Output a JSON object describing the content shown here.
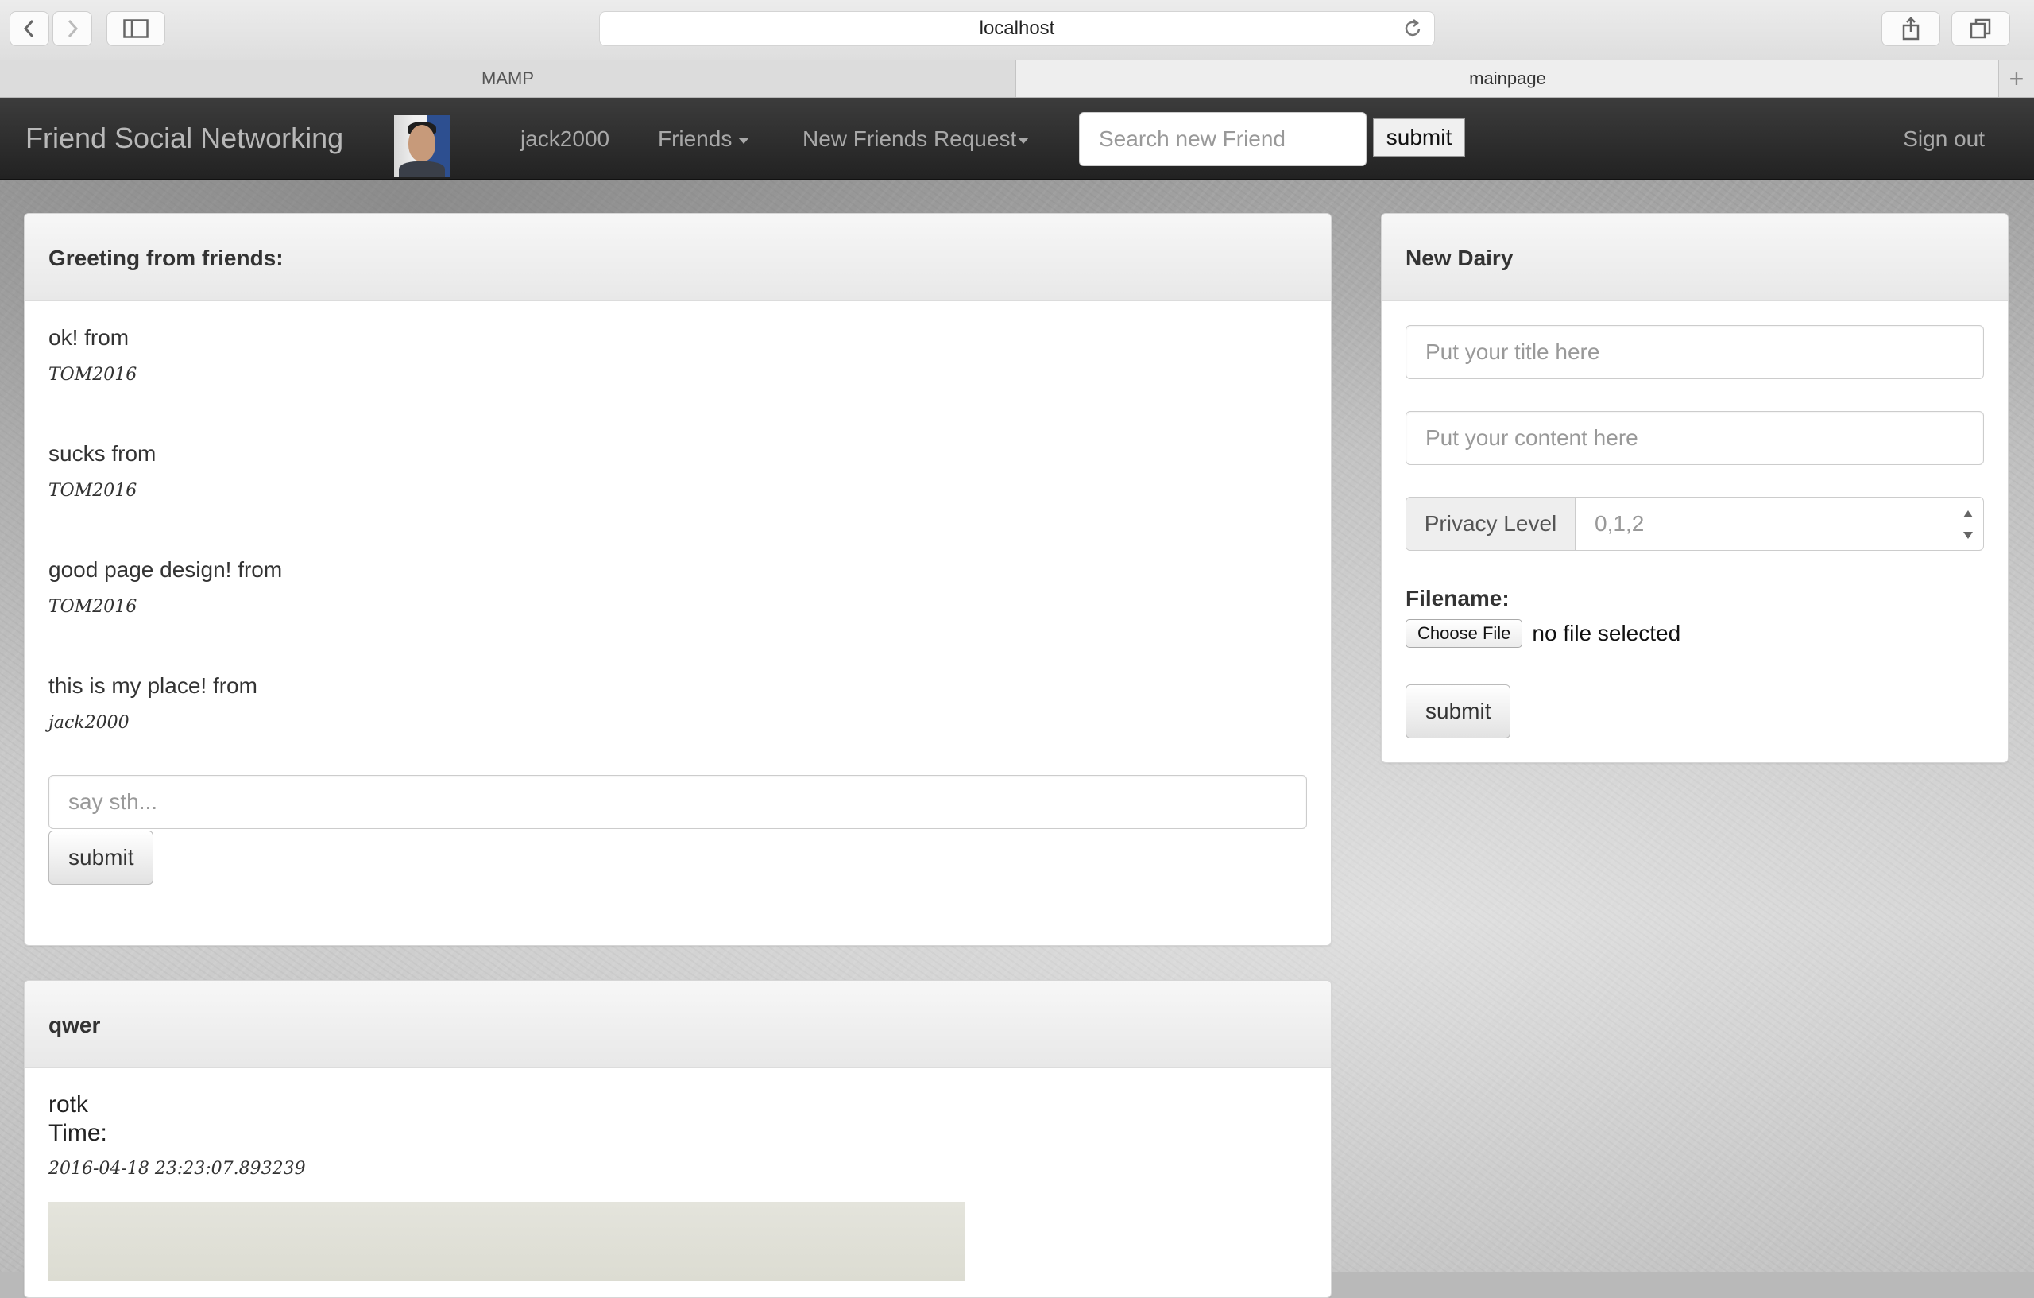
{
  "browser": {
    "url": "localhost",
    "tabs": [
      {
        "label": "MAMP",
        "active": false
      },
      {
        "label": "mainpage",
        "active": true
      }
    ]
  },
  "navbar": {
    "brand": "Friend Social Networking",
    "username": "jack2000",
    "friends_label": "Friends",
    "requests_label": "New Friends Request",
    "search_placeholder": "Search new Friend",
    "search_submit": "submit",
    "signout": "Sign out"
  },
  "greeting_panel": {
    "heading": "Greeting from friends:",
    "messages": [
      {
        "text": "ok! from",
        "author": "TOM2016"
      },
      {
        "text": "sucks from",
        "author": "TOM2016"
      },
      {
        "text": "good page design! from",
        "author": "TOM2016"
      },
      {
        "text": "this is my place! from",
        "author": "jack2000"
      }
    ],
    "input_placeholder": "say sth...",
    "submit_label": "submit"
  },
  "new_diary_panel": {
    "heading": "New Dairy",
    "title_placeholder": "Put your title here",
    "content_placeholder": "Put your content here",
    "privacy_label": "Privacy Level",
    "privacy_placeholder": "0,1,2",
    "filename_label": "Filename:",
    "choose_file_label": "Choose File",
    "file_status": "no file selected",
    "submit_label": "submit"
  },
  "diary_entry": {
    "heading": "qwer",
    "title": "rotk",
    "time_label": "Time:",
    "timestamp": "2016-04-18 23:23:07.893239"
  },
  "colors": {
    "navbar_bg": "#2b2b2b",
    "navbar_text": "#a8a8a8",
    "panel_heading_bg": "#eeeeee"
  }
}
